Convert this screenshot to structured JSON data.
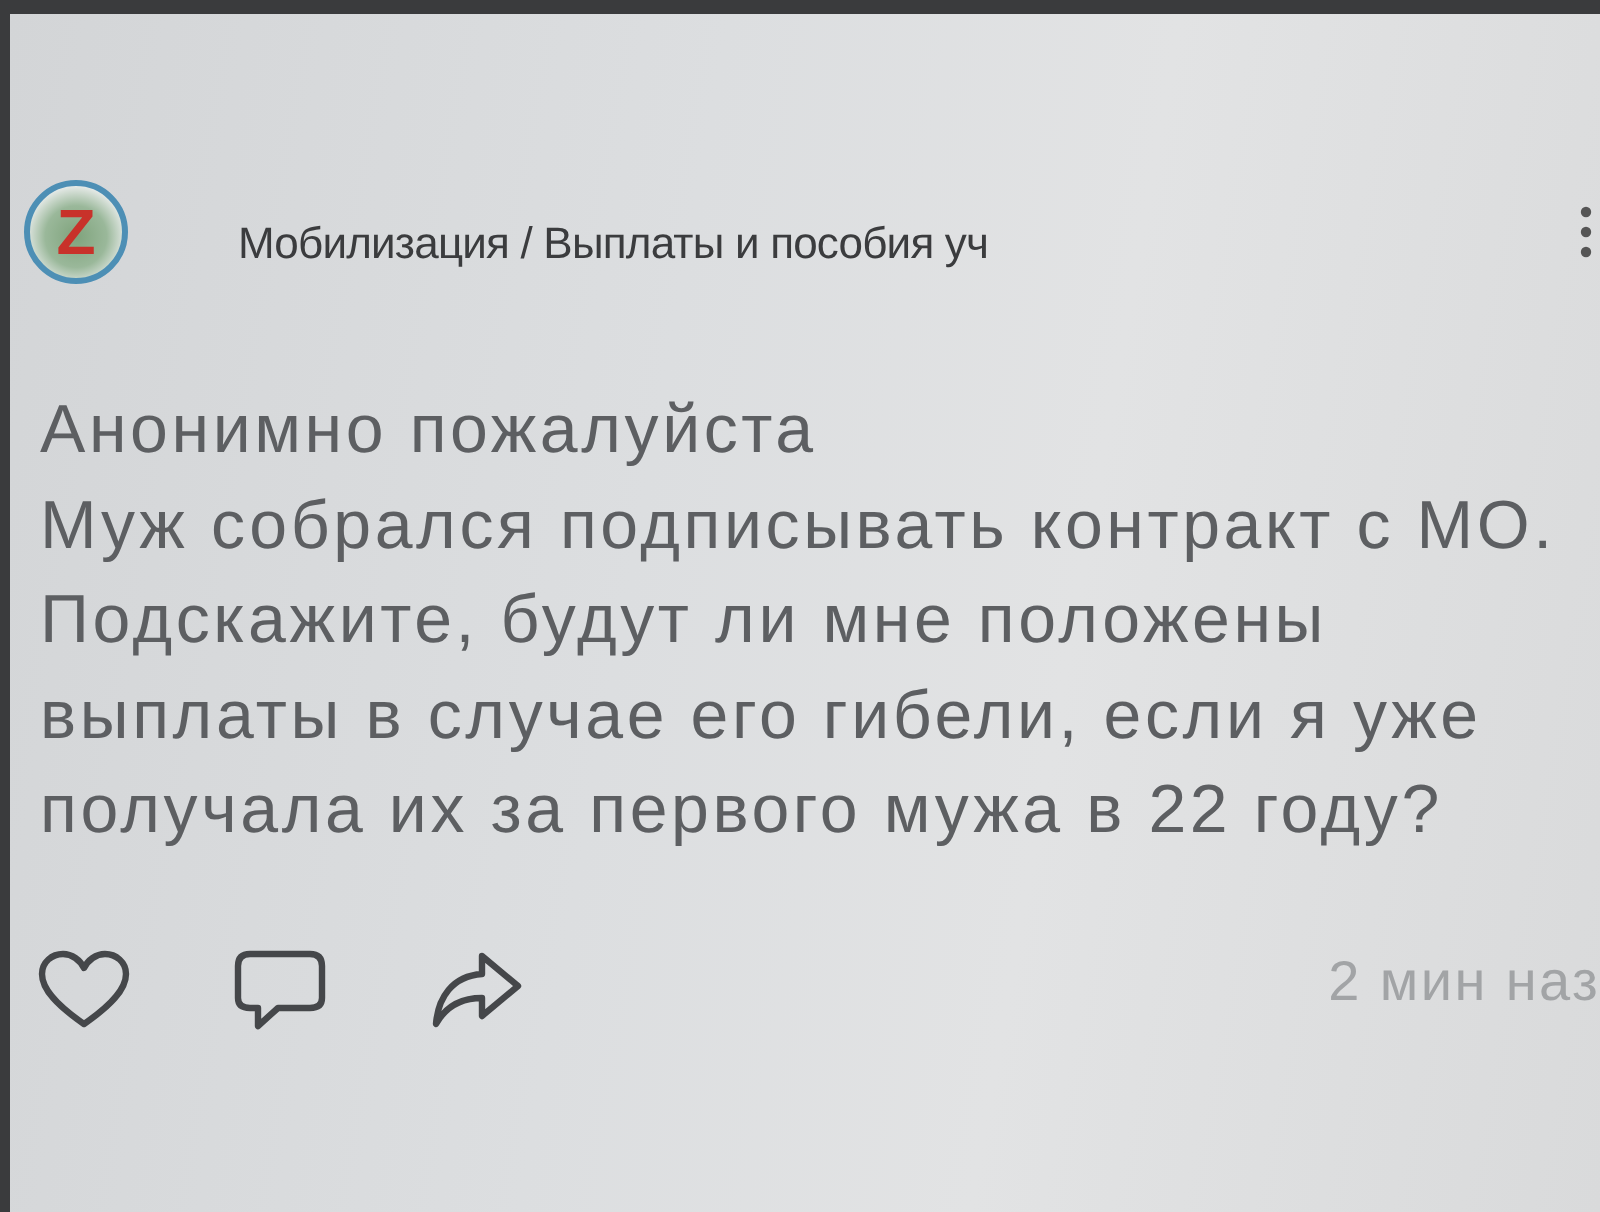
{
  "post": {
    "avatar_letter": "Z",
    "author": "Мобилизация / Выплаты и пособия уч",
    "text": "Анонимно пожалуйста\nМуж собрался подписывать контракт с МО.\nПодскажите, будут ли мне положены\nвыплаты в случае его гибели, если я уже\nполучала их за первого мужа в 22 году?",
    "time": "2 мин наз"
  }
}
